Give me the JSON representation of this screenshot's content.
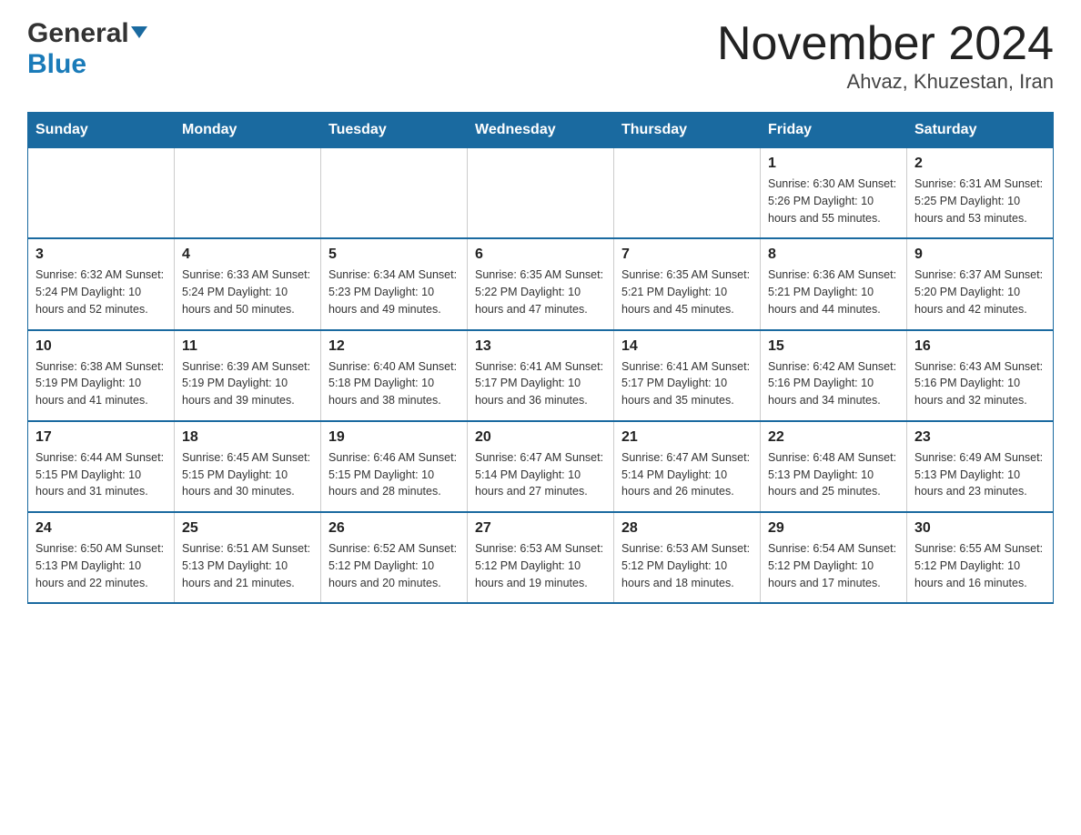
{
  "header": {
    "logo_general": "General",
    "logo_blue": "Blue",
    "title": "November 2024",
    "subtitle": "Ahvaz, Khuzestan, Iran"
  },
  "calendar": {
    "days_of_week": [
      "Sunday",
      "Monday",
      "Tuesday",
      "Wednesday",
      "Thursday",
      "Friday",
      "Saturday"
    ],
    "weeks": [
      [
        {
          "day": "",
          "info": ""
        },
        {
          "day": "",
          "info": ""
        },
        {
          "day": "",
          "info": ""
        },
        {
          "day": "",
          "info": ""
        },
        {
          "day": "",
          "info": ""
        },
        {
          "day": "1",
          "info": "Sunrise: 6:30 AM\nSunset: 5:26 PM\nDaylight: 10 hours and 55 minutes."
        },
        {
          "day": "2",
          "info": "Sunrise: 6:31 AM\nSunset: 5:25 PM\nDaylight: 10 hours and 53 minutes."
        }
      ],
      [
        {
          "day": "3",
          "info": "Sunrise: 6:32 AM\nSunset: 5:24 PM\nDaylight: 10 hours and 52 minutes."
        },
        {
          "day": "4",
          "info": "Sunrise: 6:33 AM\nSunset: 5:24 PM\nDaylight: 10 hours and 50 minutes."
        },
        {
          "day": "5",
          "info": "Sunrise: 6:34 AM\nSunset: 5:23 PM\nDaylight: 10 hours and 49 minutes."
        },
        {
          "day": "6",
          "info": "Sunrise: 6:35 AM\nSunset: 5:22 PM\nDaylight: 10 hours and 47 minutes."
        },
        {
          "day": "7",
          "info": "Sunrise: 6:35 AM\nSunset: 5:21 PM\nDaylight: 10 hours and 45 minutes."
        },
        {
          "day": "8",
          "info": "Sunrise: 6:36 AM\nSunset: 5:21 PM\nDaylight: 10 hours and 44 minutes."
        },
        {
          "day": "9",
          "info": "Sunrise: 6:37 AM\nSunset: 5:20 PM\nDaylight: 10 hours and 42 minutes."
        }
      ],
      [
        {
          "day": "10",
          "info": "Sunrise: 6:38 AM\nSunset: 5:19 PM\nDaylight: 10 hours and 41 minutes."
        },
        {
          "day": "11",
          "info": "Sunrise: 6:39 AM\nSunset: 5:19 PM\nDaylight: 10 hours and 39 minutes."
        },
        {
          "day": "12",
          "info": "Sunrise: 6:40 AM\nSunset: 5:18 PM\nDaylight: 10 hours and 38 minutes."
        },
        {
          "day": "13",
          "info": "Sunrise: 6:41 AM\nSunset: 5:17 PM\nDaylight: 10 hours and 36 minutes."
        },
        {
          "day": "14",
          "info": "Sunrise: 6:41 AM\nSunset: 5:17 PM\nDaylight: 10 hours and 35 minutes."
        },
        {
          "day": "15",
          "info": "Sunrise: 6:42 AM\nSunset: 5:16 PM\nDaylight: 10 hours and 34 minutes."
        },
        {
          "day": "16",
          "info": "Sunrise: 6:43 AM\nSunset: 5:16 PM\nDaylight: 10 hours and 32 minutes."
        }
      ],
      [
        {
          "day": "17",
          "info": "Sunrise: 6:44 AM\nSunset: 5:15 PM\nDaylight: 10 hours and 31 minutes."
        },
        {
          "day": "18",
          "info": "Sunrise: 6:45 AM\nSunset: 5:15 PM\nDaylight: 10 hours and 30 minutes."
        },
        {
          "day": "19",
          "info": "Sunrise: 6:46 AM\nSunset: 5:15 PM\nDaylight: 10 hours and 28 minutes."
        },
        {
          "day": "20",
          "info": "Sunrise: 6:47 AM\nSunset: 5:14 PM\nDaylight: 10 hours and 27 minutes."
        },
        {
          "day": "21",
          "info": "Sunrise: 6:47 AM\nSunset: 5:14 PM\nDaylight: 10 hours and 26 minutes."
        },
        {
          "day": "22",
          "info": "Sunrise: 6:48 AM\nSunset: 5:13 PM\nDaylight: 10 hours and 25 minutes."
        },
        {
          "day": "23",
          "info": "Sunrise: 6:49 AM\nSunset: 5:13 PM\nDaylight: 10 hours and 23 minutes."
        }
      ],
      [
        {
          "day": "24",
          "info": "Sunrise: 6:50 AM\nSunset: 5:13 PM\nDaylight: 10 hours and 22 minutes."
        },
        {
          "day": "25",
          "info": "Sunrise: 6:51 AM\nSunset: 5:13 PM\nDaylight: 10 hours and 21 minutes."
        },
        {
          "day": "26",
          "info": "Sunrise: 6:52 AM\nSunset: 5:12 PM\nDaylight: 10 hours and 20 minutes."
        },
        {
          "day": "27",
          "info": "Sunrise: 6:53 AM\nSunset: 5:12 PM\nDaylight: 10 hours and 19 minutes."
        },
        {
          "day": "28",
          "info": "Sunrise: 6:53 AM\nSunset: 5:12 PM\nDaylight: 10 hours and 18 minutes."
        },
        {
          "day": "29",
          "info": "Sunrise: 6:54 AM\nSunset: 5:12 PM\nDaylight: 10 hours and 17 minutes."
        },
        {
          "day": "30",
          "info": "Sunrise: 6:55 AM\nSunset: 5:12 PM\nDaylight: 10 hours and 16 minutes."
        }
      ]
    ]
  }
}
